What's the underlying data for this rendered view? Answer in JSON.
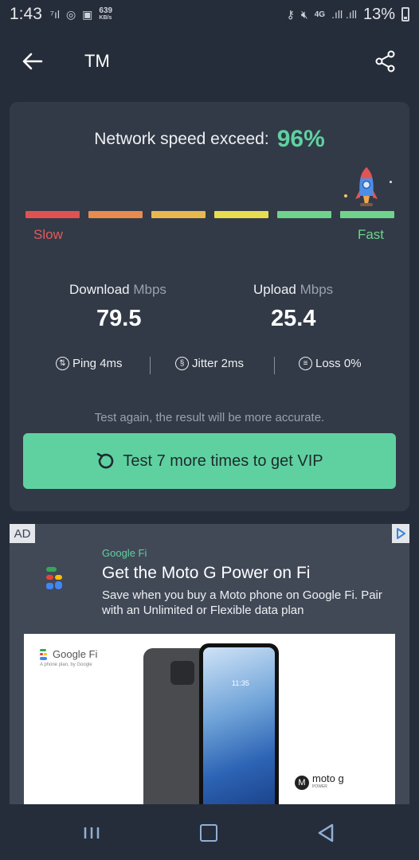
{
  "status_bar": {
    "time": "1:43",
    "net_speed_value": "639",
    "net_speed_unit": "KB/s",
    "network": "4G",
    "battery": "13%"
  },
  "app_bar": {
    "title": "TM"
  },
  "result": {
    "exceed_label": "Network speed exceed:",
    "exceed_value": "96%",
    "scale_slow": "Slow",
    "scale_fast": "Fast",
    "scale_colors": [
      "#e05252",
      "#e88b4f",
      "#e8b84f",
      "#e8dd4f",
      "#6fd38c",
      "#6fd38c"
    ],
    "download_label": "Download",
    "download_unit": "Mbps",
    "download_value": "79.5",
    "upload_label": "Upload",
    "upload_unit": "Mbps",
    "upload_value": "25.4",
    "ping": "Ping 4ms",
    "jitter": "Jitter 2ms",
    "loss": "Loss 0%",
    "hint": "Test again, the result will be more accurate.",
    "vip_button": "Test 7 more times to get VIP",
    "accent_color": "#5fd1a0"
  },
  "ad": {
    "badge": "AD",
    "sponsor": "Google Fi",
    "headline": "Get the Moto G Power on Fi",
    "body": "Save when you buy a Moto phone on Google Fi. Pair with an Unlimited or Flexible data plan",
    "image_brand": "Google Fi",
    "image_tagline": "A phone plan, by Google",
    "image_phone_time": "11:35",
    "image_product": "moto g",
    "image_product_sub": "POWER"
  }
}
